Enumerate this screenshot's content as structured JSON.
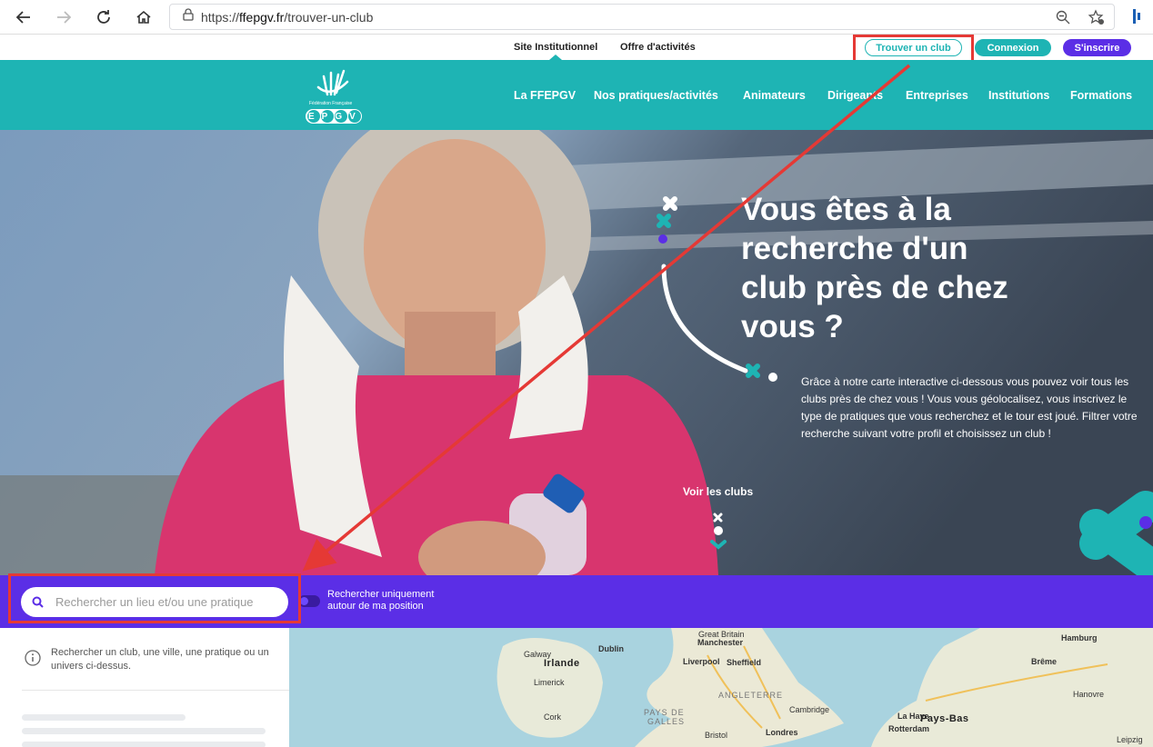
{
  "browser": {
    "url_prefix": "https://",
    "url_host": "ffepgv.fr",
    "url_path": "/trouver-un-club"
  },
  "util_nav": {
    "links": [
      "Site Institutionnel",
      "Offre d'activités"
    ],
    "find_club": "Trouver un club",
    "login": "Connexion",
    "signup": "S'inscrire"
  },
  "logo": {
    "small_text": "Fédération Française",
    "letters": "EPGV"
  },
  "main_nav": [
    "La FFEPGV",
    "Nos pratiques/activités",
    "Animateurs",
    "Dirigeants",
    "Entreprises",
    "Institutions",
    "Formations"
  ],
  "hero": {
    "title_lines": [
      "Vous êtes à la",
      "recherche d'un",
      "club près de chez",
      "vous ?"
    ],
    "description": "Grâce à notre carte interactive ci-dessous vous pouvez voir tous les clubs près de chez vous ! Vous vous géolocalisez, vous inscrivez le type de pratiques que vous recherchez et le tour est joué. Filtrer votre recherche suivant votre profil et choisissez un club !",
    "cta": "Voir les clubs"
  },
  "search": {
    "placeholder": "Rechercher un lieu et/ou une pratique",
    "toggle_line1": "Rechercher uniquement",
    "toggle_line2": "autour de ma position"
  },
  "sidebar": {
    "info": "Rechercher un club, une ville, une pratique ou un univers ci-dessus."
  },
  "map": {
    "labels": [
      "Great Britain",
      "Galway",
      "Dublin",
      "Manchester",
      "Liverpool",
      "Sheffield",
      "Irlande",
      "Limerick",
      "Cork",
      "ANGLETERRE",
      "Cambridge",
      "PAYS DE",
      "GALLES",
      "Bristol",
      "Londres",
      "Hamburg",
      "Brême",
      "Hanovre",
      "La Haye",
      "Pays-Bas",
      "Rotterdam",
      "Leipzig"
    ]
  },
  "colors": {
    "teal": "#1eb4b4",
    "purple": "#5b2ee6",
    "annotation": "#e53935"
  }
}
